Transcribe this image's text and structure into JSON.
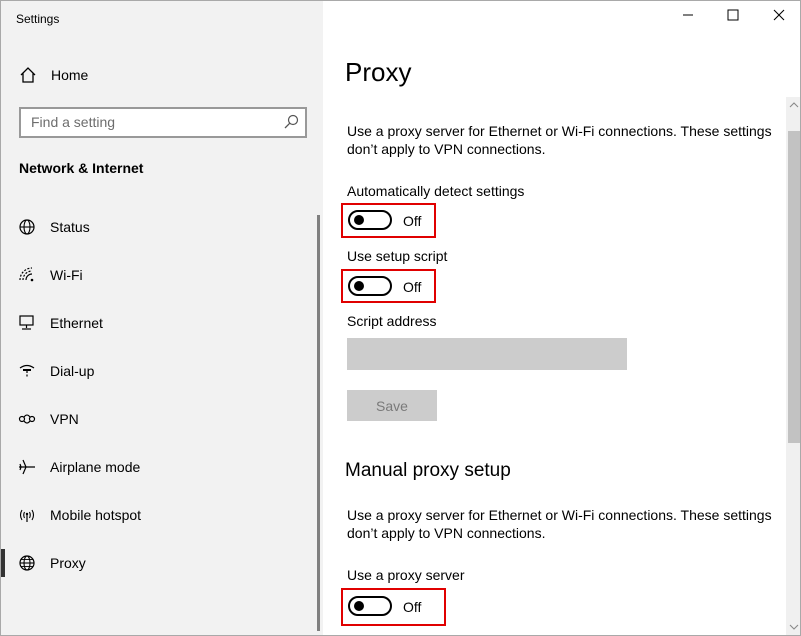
{
  "window": {
    "title": "Settings",
    "controls": [
      "minimize",
      "maximize",
      "close"
    ]
  },
  "sidebar": {
    "home_label": "Home",
    "search_placeholder": "Find a setting",
    "section_title": "Network & Internet",
    "items": [
      {
        "label": "Status",
        "icon": "globe-status-icon"
      },
      {
        "label": "Wi-Fi",
        "icon": "wifi-icon"
      },
      {
        "label": "Ethernet",
        "icon": "ethernet-icon"
      },
      {
        "label": "Dial-up",
        "icon": "dialup-icon"
      },
      {
        "label": "VPN",
        "icon": "vpn-icon"
      },
      {
        "label": "Airplane mode",
        "icon": "airplane-icon"
      },
      {
        "label": "Mobile hotspot",
        "icon": "hotspot-icon"
      },
      {
        "label": "Proxy",
        "icon": "globe-icon",
        "selected": true
      }
    ]
  },
  "main": {
    "title": "Proxy",
    "auto_section": {
      "description": "Use a proxy server for Ethernet or Wi-Fi connections. These settings don’t apply to VPN connections.",
      "auto_detect": {
        "label": "Automatically detect settings",
        "state": "Off"
      },
      "setup_script": {
        "label": "Use setup script",
        "state": "Off"
      },
      "script_address": {
        "label": "Script address",
        "value": ""
      },
      "save_label": "Save"
    },
    "manual_section": {
      "heading": "Manual proxy setup",
      "description": "Use a proxy server for Ethernet or Wi-Fi connections. These settings don’t apply to VPN connections.",
      "use_proxy": {
        "label": "Use a proxy server",
        "state": "Off"
      }
    }
  },
  "colors": {
    "sidebar_bg": "#f2f2f2",
    "highlight_border": "#e00000",
    "disabled_bg": "#cccccc"
  }
}
